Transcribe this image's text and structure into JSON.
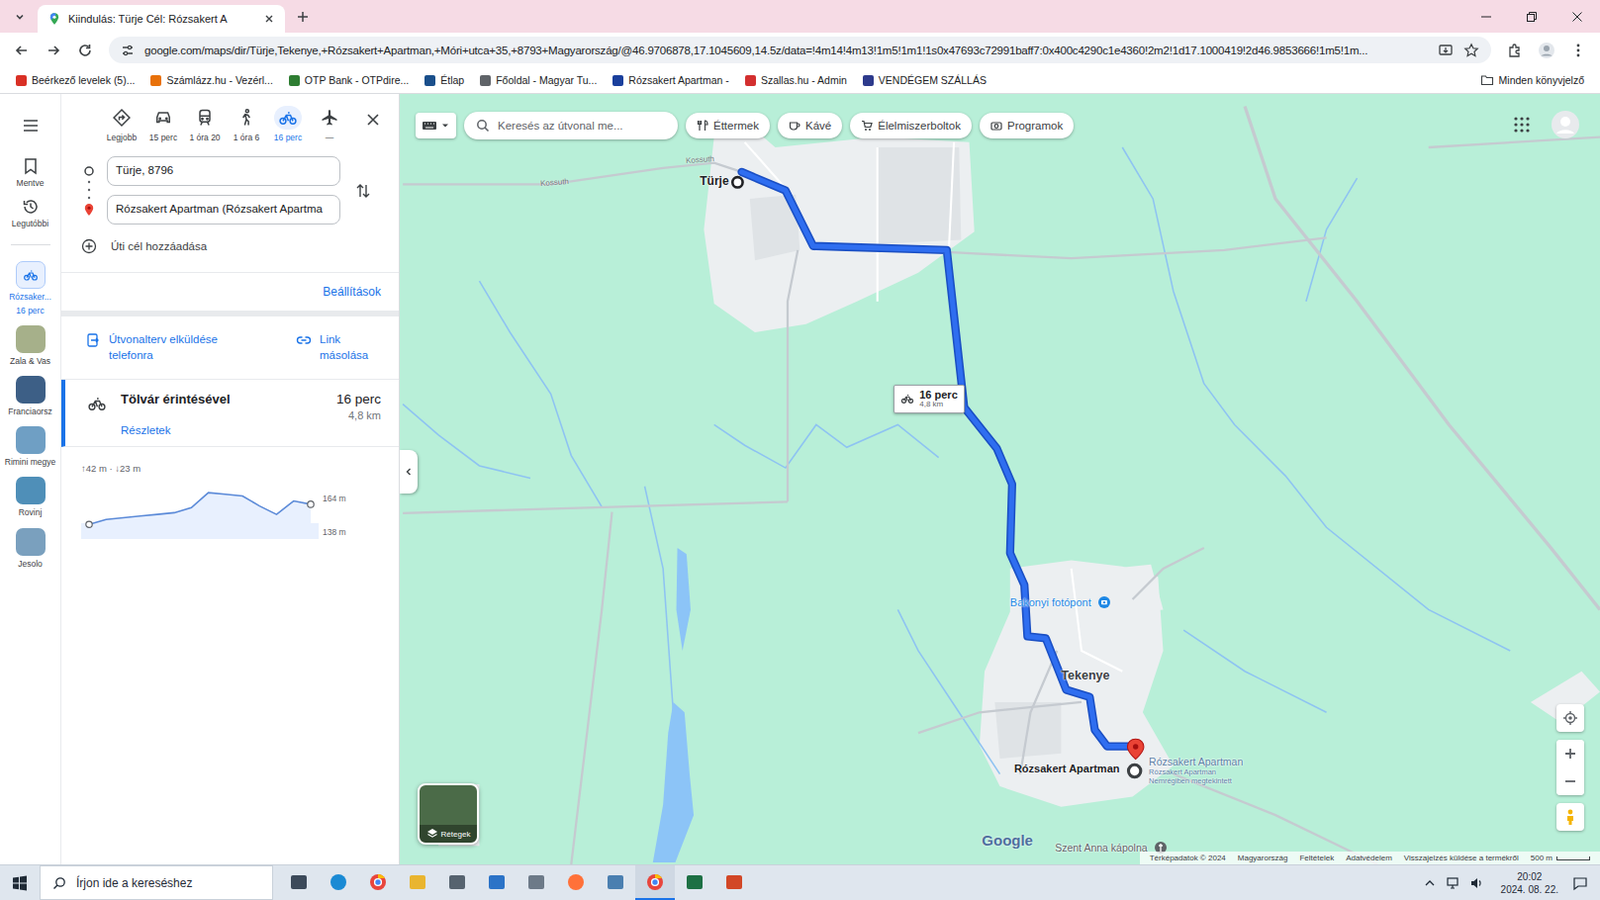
{
  "browser": {
    "tab": {
      "title": "Kiindulás: Türje Cél: Rózsakert A",
      "selected": true
    },
    "url": "google.com/maps/dir/Türje,Tekenye,+Rózsakert+Apartman,+Móri+utca+35,+8793+Magyarország/@46.9706878,17.1045609,14.5z/data=!4m14!4m13!1m5!1m1!1s0x47693c72991baff7:0x400c4290c1e4360!2m2!1d17.1000419!2d46.9853666!1m5!1m...",
    "bookmarks": [
      {
        "label": "Beérkező levelek (5)...",
        "color": "#d93025"
      },
      {
        "label": "Számlázz.hu - Vezérl...",
        "color": "#e8710a"
      },
      {
        "label": "OTP Bank - OTPdire...",
        "color": "#2e7d32"
      },
      {
        "label": "Étlap",
        "color": "#1a4f8b"
      },
      {
        "label": "Főoldal - Magyar Tu...",
        "color": "#5f6368"
      },
      {
        "label": "Rózsakert Apartman -",
        "color": "#1a3f9c"
      },
      {
        "label": "Szallas.hu - Admin",
        "color": "#d32f2f"
      },
      {
        "label": "VENDÉGEM SZÁLLÁS",
        "color": "#2d3a8c"
      }
    ],
    "all_bookmarks": "Minden könyvjelző"
  },
  "rail": {
    "items": [
      {
        "label": "Mentve",
        "kind": "saved"
      },
      {
        "label": "Legutóbbi",
        "kind": "recent"
      }
    ],
    "places": [
      {
        "label": "Rózsaker...",
        "sub": "16 perc",
        "kind": "route",
        "selected": true
      },
      {
        "label": "Zala & Vas",
        "kind": "photo",
        "selected": false
      },
      {
        "label": "Franciaorsz",
        "kind": "photo",
        "selected": false
      },
      {
        "label": "Rimini megye",
        "kind": "photo",
        "selected": false
      },
      {
        "label": "Rovinj",
        "kind": "photo",
        "selected": false
      },
      {
        "label": "Jesolo",
        "kind": "photo",
        "selected": false
      }
    ]
  },
  "directions": {
    "modes": [
      {
        "kind": "best",
        "label": "Legjobb",
        "selected": false
      },
      {
        "kind": "car",
        "label": "15 perc",
        "selected": false
      },
      {
        "kind": "transit",
        "label": "1 óra 20",
        "selected": false
      },
      {
        "kind": "walk",
        "label": "1 óra 6",
        "selected": false
      },
      {
        "kind": "bike",
        "label": "16 perc",
        "selected": true
      },
      {
        "kind": "flight",
        "label": "—",
        "selected": false
      }
    ],
    "origin": "Türje, 8796",
    "destination": "Rózsakert Apartman (Rózsakert Apartma",
    "add_stop": "Úti cél hozzáadása",
    "settings": "Beállítások",
    "send": "Útvonalterv elküldése telefonra",
    "copy": "Link másolása",
    "routes": [
      {
        "via": "Tölvár érintésével",
        "time": "16 perc",
        "distance": "4,8 km",
        "details": "Részletek",
        "selected": true
      }
    ],
    "elevation": {
      "summary": "↑42 m · ↓23 m",
      "max_label": "164 m",
      "min_label": "138 m",
      "min": 138,
      "max": 164,
      "profile": [
        142,
        145,
        146,
        147,
        148,
        149,
        152,
        161,
        160,
        159,
        153,
        148,
        156,
        154
      ]
    }
  },
  "map": {
    "search": "Keresés az útvonal me...",
    "chips": [
      "Éttermek",
      "Kávé",
      "Élelmiszerboltok",
      "Programok"
    ],
    "places": [
      {
        "name": "Türje",
        "kind": "origin"
      },
      {
        "name": "Tekenye",
        "kind": "town"
      },
      {
        "name": "Bakonyi fotópont",
        "kind": "poi"
      },
      {
        "name": "Rózsakert Apartman",
        "kind": "destination"
      },
      {
        "name": "Rózsakert Apartman",
        "kind": "saved",
        "note": "Rózsakert Apartman Nemrégiben megtekintett"
      },
      {
        "name": "Szent Anna kápolna",
        "kind": "church"
      }
    ],
    "streets": [
      "Kossuth",
      "Kossuth"
    ],
    "route_badge": {
      "time": "16 perc",
      "distance": "4,8 km"
    },
    "layers": "Rétegek",
    "logo": "Google",
    "footer": [
      "Térképadatok © 2024",
      "Magyarország",
      "Feltételek",
      "Adatvédelem",
      "Visszajelzés küldése a termékről"
    ],
    "scale": "500 m"
  },
  "taskbar": {
    "search": "Írjon ide a kereséshez",
    "apps": [
      {
        "kind": "taskview",
        "selected": false
      },
      {
        "kind": "edge",
        "selected": false
      },
      {
        "kind": "chrome",
        "selected": false
      },
      {
        "kind": "folder",
        "selected": false
      },
      {
        "kind": "calculator",
        "selected": false
      },
      {
        "kind": "monitor",
        "selected": false
      },
      {
        "kind": "notepad",
        "selected": false
      },
      {
        "kind": "firefox",
        "selected": false
      },
      {
        "kind": "photos",
        "selected": false
      },
      {
        "kind": "chrome",
        "selected": true
      },
      {
        "kind": "excel",
        "selected": false
      },
      {
        "kind": "powerpoint",
        "selected": false
      }
    ],
    "time": "20:02",
    "date": "2024. 08. 22."
  }
}
